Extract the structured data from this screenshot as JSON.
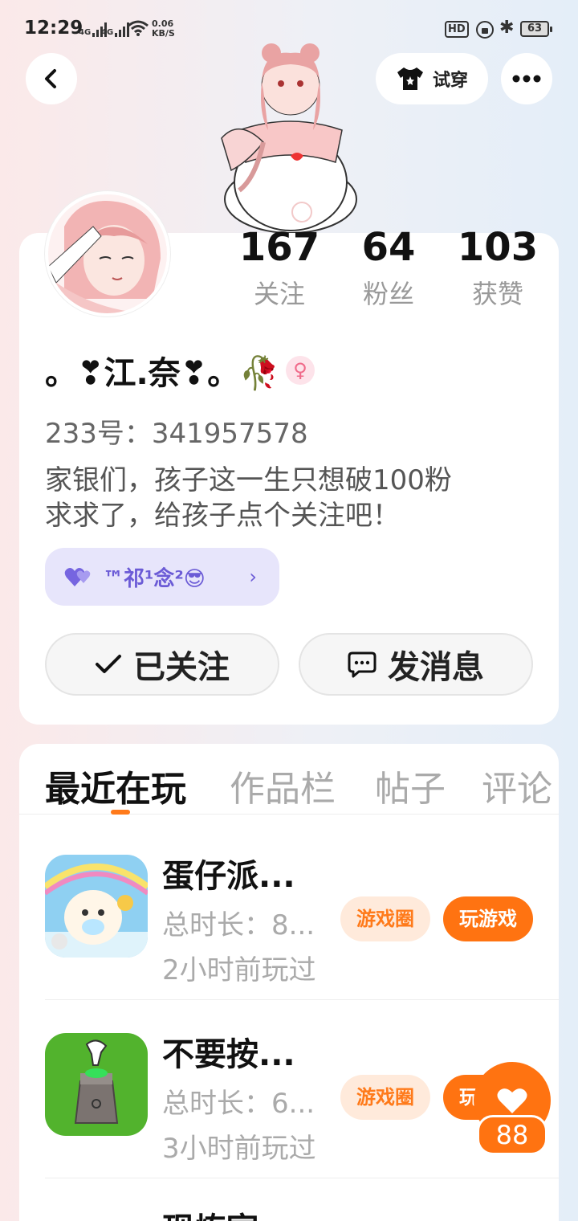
{
  "status_bar": {
    "time": "12:29",
    "signal1": "4G",
    "signal2": "4G",
    "speed_value": "0.06",
    "speed_unit": "KB/S",
    "hd": "HD",
    "battery": "63"
  },
  "nav": {
    "back_icon": "chevron-left",
    "tryon_label": "试穿",
    "more_icon": "more-dots"
  },
  "profile": {
    "stats": [
      {
        "num": "167",
        "label": "关注"
      },
      {
        "num": "64",
        "label": "粉丝"
      },
      {
        "num": "103",
        "label": "获赞"
      }
    ],
    "nickname": "。❣江.奈❣。🥀",
    "gender_symbol": "♀",
    "uid": "233号：341957578",
    "bio_line1": "家银们，孩子这一生只想破100粉",
    "bio_line2": "求求了，给孩子点个关注吧！",
    "tag": "™祁¹念²😎",
    "follow_label": "已关注",
    "message_label": "发消息"
  },
  "tabs": [
    "最近在玩",
    "作品栏",
    "帖子",
    "评论"
  ],
  "games": [
    {
      "name": "蛋仔派...",
      "duration": "总时长：8...",
      "last_played": "2小时前玩过",
      "circle_label": "游戏圈",
      "play_label": "玩游戏"
    },
    {
      "name": "不要按...",
      "duration": "总时长：6...",
      "last_played": "3小时前玩过",
      "circle_label": "游戏圈",
      "play_label": "玩游戏"
    },
    {
      "name": "现炼室"
    }
  ],
  "floating": {
    "like_count": "88"
  },
  "colors": {
    "accent": "#ff7311",
    "accent_light": "#ffeadb",
    "tag_bg": "#e7e5fb"
  }
}
